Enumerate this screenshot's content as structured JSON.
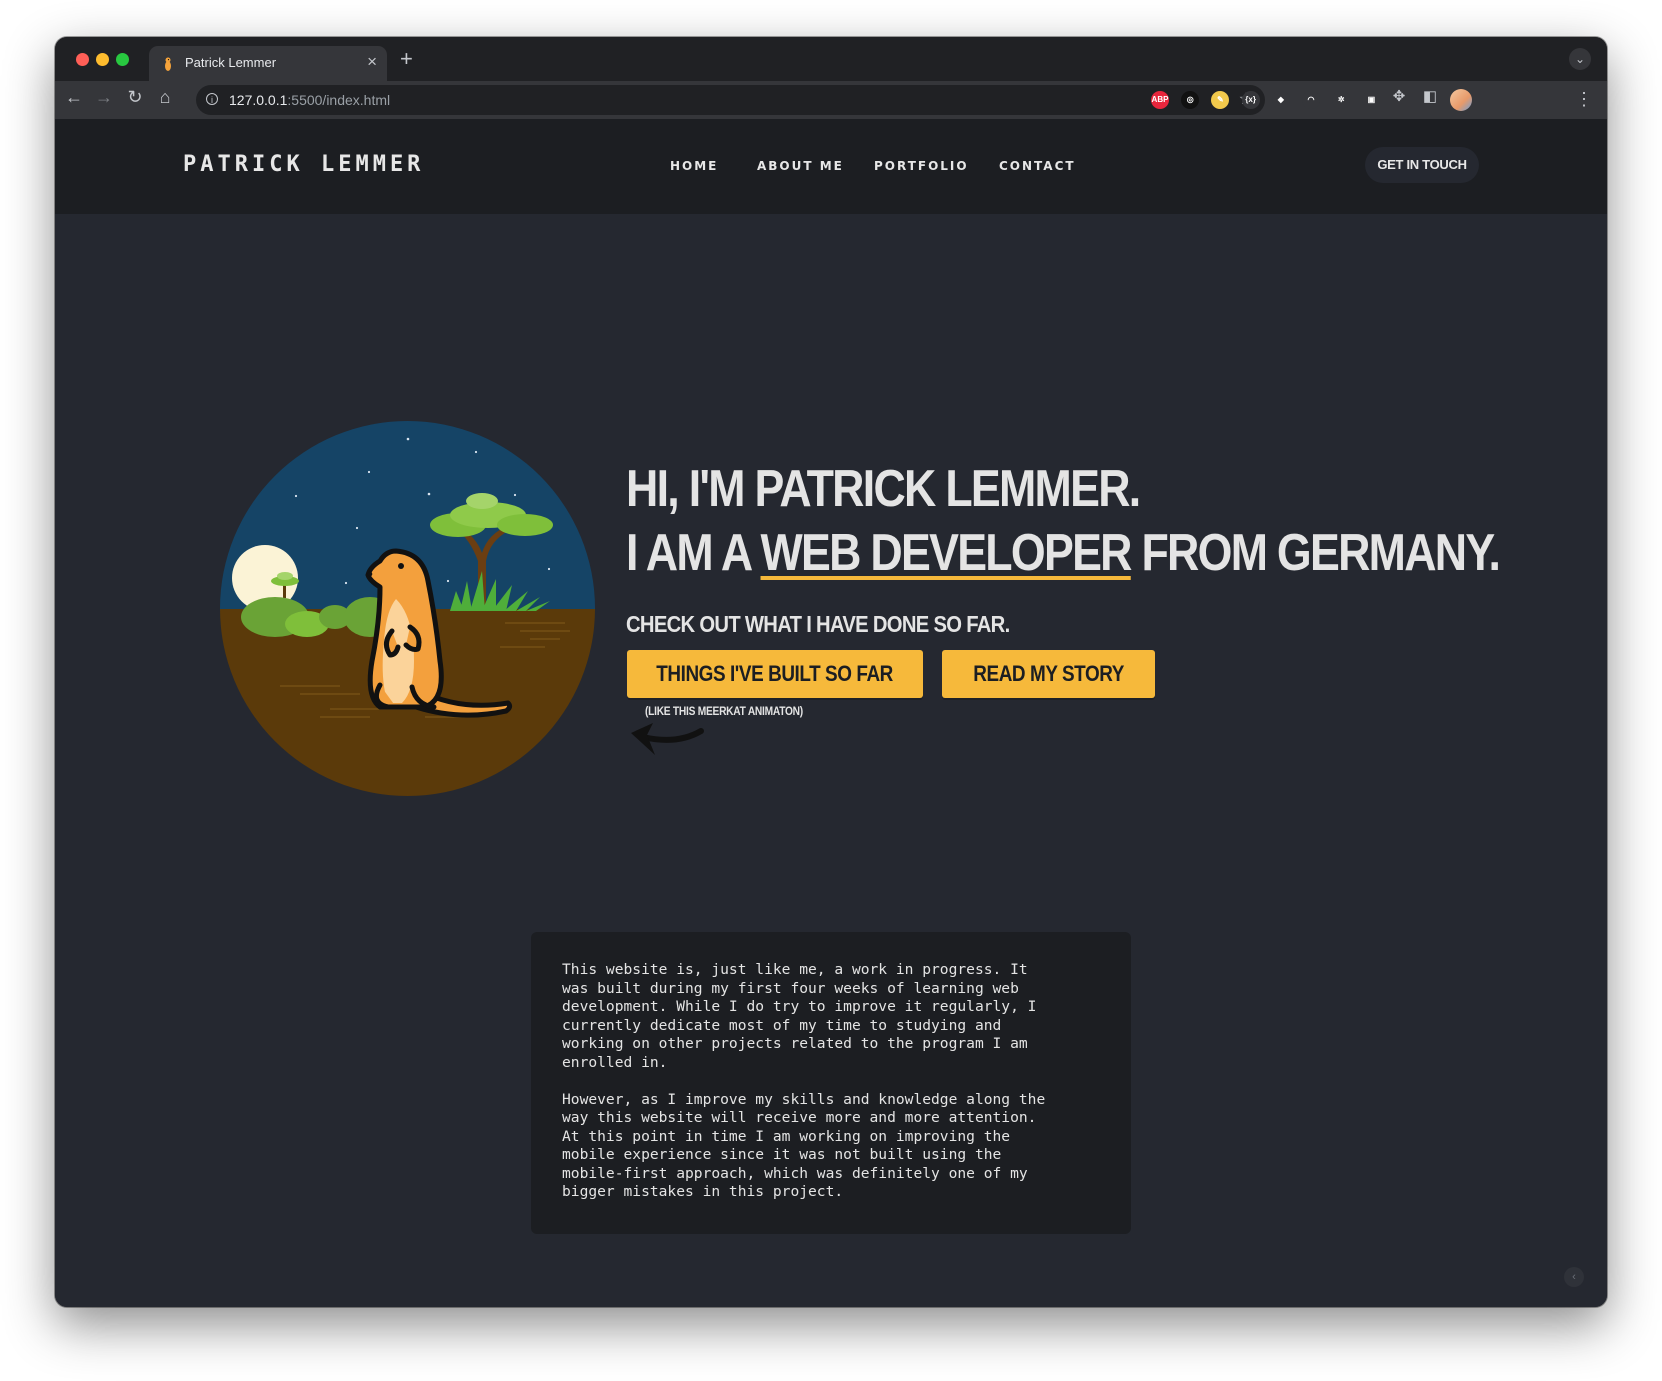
{
  "browser": {
    "tab_title": "Patrick Lemmer",
    "tab_close": "×",
    "new_tab": "+",
    "tab_menu": "⌄",
    "url_host": "127.0.0.1",
    "url_rest": ":5500/index.html",
    "extensions": [
      {
        "name": "adblock-plus-icon",
        "label": "ABP",
        "color": "#e8263d"
      },
      {
        "name": "extension-icon-2",
        "label": "◎",
        "color": "#111111"
      },
      {
        "name": "extension-icon-3",
        "label": "✎",
        "color": "#f2c94c"
      },
      {
        "name": "extension-icon-4",
        "label": "{x}",
        "color": "#35363a"
      },
      {
        "name": "extension-icon-5",
        "label": "◆",
        "color": "#35363a"
      },
      {
        "name": "extension-icon-6",
        "label": "◠",
        "color": "#35363a"
      },
      {
        "name": "extension-icon-7",
        "label": "✲",
        "color": "#35363a"
      },
      {
        "name": "extension-icon-8",
        "label": "▣",
        "color": "#35363a"
      }
    ]
  },
  "site": {
    "logo": "PATRICK LEMMER",
    "nav": [
      "HOME",
      "ABOUT ME",
      "PORTFOLIO",
      "CONTACT"
    ],
    "cta": "GET IN TOUCH"
  },
  "hero": {
    "line1": "HI, I'M PATRICK LEMMER.",
    "line2_prefix": "I AM A ",
    "line2_highlight": "WEB DEVELOPER",
    "line2_suffix": " FROM GERMANY.",
    "subtitle": "CHECK OUT WHAT I HAVE DONE SO FAR.",
    "primary_button": "THINGS I'VE BUILT SO FAR",
    "secondary_button": "READ MY STORY",
    "hint": "(LIKE THIS MEERKAT ANIMATON)"
  },
  "notice": {
    "paragraph1": "This website is, just like me, a work in progress. It\nwas built during my first four weeks of learning web\ndevelopment. While I do try to improve it regularly, I\ncurrently dedicate most of my time to studying and\nworking on other projects related to the program I am\nenrolled in.",
    "paragraph2": "However, as I improve my skills and knowledge along the\nway this website will receive more and more attention.\nAt this point in time I am working on improving the\nmobile experience since it was not built using the\nmobile-first approach, which was definitely one of my\nbigger mistakes in this project."
  },
  "colors": {
    "page_bg": "#252830",
    "header_bg": "#1c1e22",
    "accent": "#f6b93b",
    "text": "#e4e4e4"
  }
}
